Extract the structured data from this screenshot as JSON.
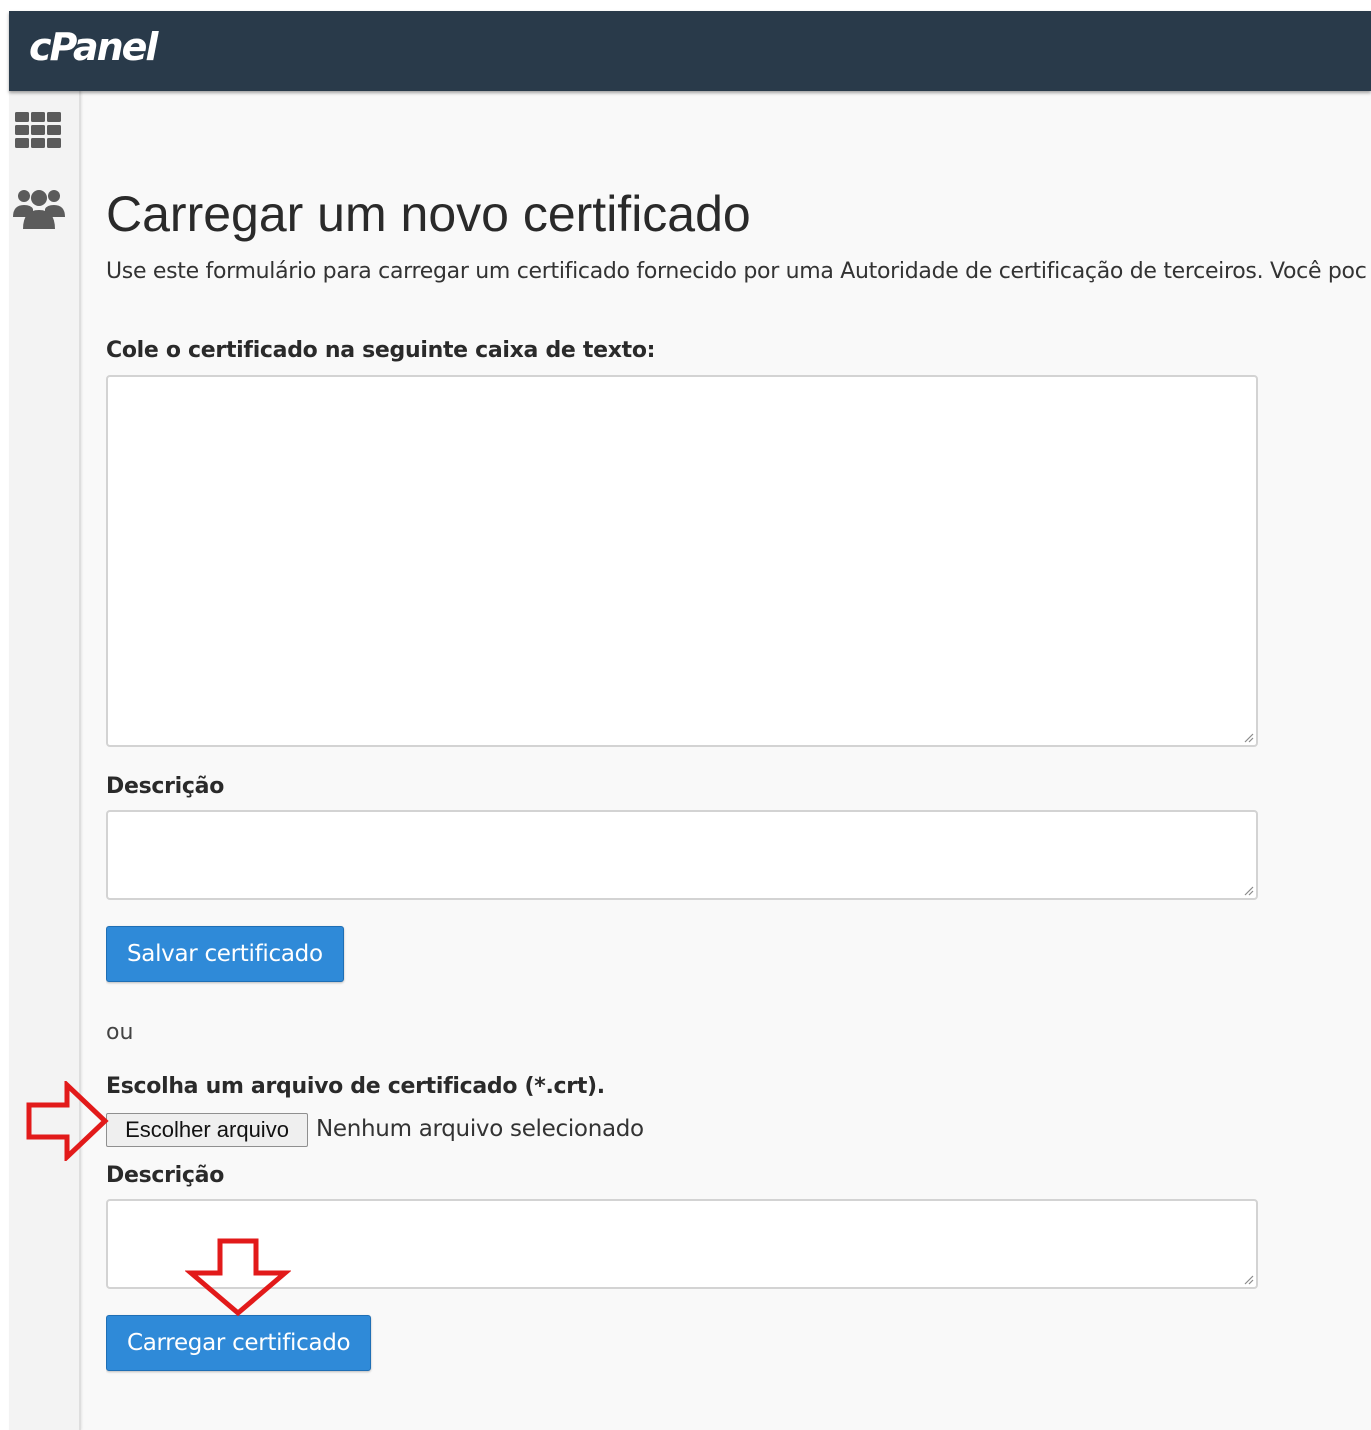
{
  "header": {
    "logo_text": "cPanel"
  },
  "sidebar": {
    "items": [
      {
        "icon": "grid-icon"
      },
      {
        "icon": "users-icon"
      }
    ]
  },
  "main": {
    "title": "Carregar um novo certificado",
    "description": "Use este formulário para carregar um certificado fornecido por uma Autoridade de certificação de terceiros. Você poc",
    "paste_label": "Cole o certificado na seguinte caixa de texto:",
    "paste_value": "",
    "description_label_1": "Descrição",
    "description_value_1": "",
    "save_button": "Salvar certificado",
    "or_text": "ou",
    "file_label": "Escolha um arquivo de certificado (*.crt).",
    "file_button": "Escolher arquivo",
    "file_status": "Nenhum arquivo selecionado",
    "description_label_2": "Descrição",
    "description_value_2": "",
    "upload_button": "Carregar certificado"
  },
  "colors": {
    "topbar": "#293a4a",
    "primary_button": "#2f8ad8",
    "annotation_arrow": "#e21a1a"
  }
}
